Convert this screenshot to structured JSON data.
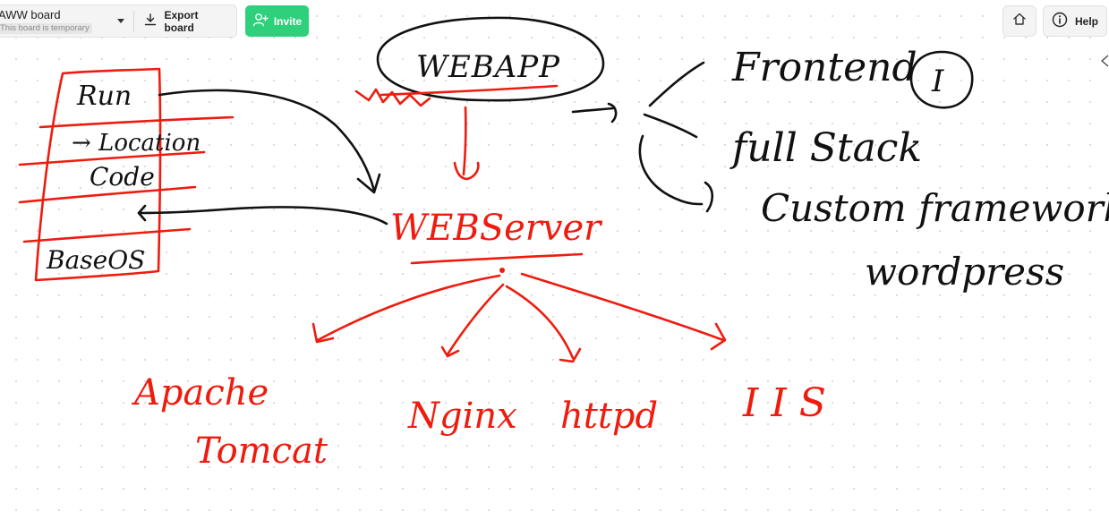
{
  "toolbar": {
    "board_name": "AWW board",
    "temp_badge": "This board is temporary",
    "export_label": "Export board",
    "invite_label": "Invite",
    "help_label": "Help"
  },
  "icons": {
    "caret": "chevron-down-icon",
    "export": "download-icon",
    "invite": "add-user-icon",
    "home": "home-icon",
    "help": "info-icon",
    "collapse": "collapse-left-icon"
  },
  "colors": {
    "invite_bg": "#2fd07c",
    "ink_red": "#ee1c0e",
    "ink_black": "#111111"
  },
  "canvas": {
    "stack_box": {
      "items": [
        "Run",
        "→ Location",
        "Code",
        "BaseOS"
      ]
    },
    "webapp_label": "WEBAPP",
    "webserver_label": "WEBServer",
    "app_types": [
      "Frontend",
      "full Stack",
      "Custom framework",
      "wordpress"
    ],
    "roman_badge": "I",
    "servers": [
      "Apache",
      "Tomcat",
      "Nginx",
      "httpd",
      "IIS"
    ]
  }
}
